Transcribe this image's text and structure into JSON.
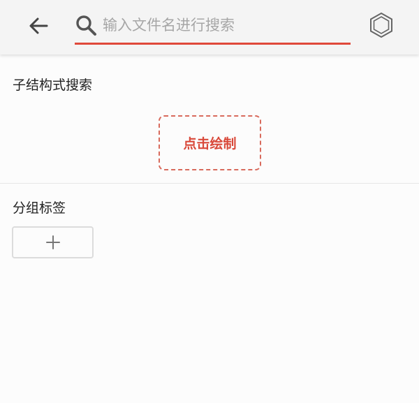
{
  "header": {
    "search_placeholder": "输入文件名进行搜索",
    "search_value": ""
  },
  "structure_search": {
    "title": "子结构式搜索",
    "draw_label": "点击绘制"
  },
  "group_tags": {
    "title": "分组标签",
    "add_symbol": "+"
  },
  "icons": {
    "back": "arrow-left-icon",
    "search": "search-icon",
    "structure": "hexagon-icon",
    "add": "plus-icon"
  },
  "colors": {
    "accent": "#e0493a",
    "dashed_border": "#d86a5c",
    "header_bg": "#f4f4f4",
    "page_bg": "#fcfcfc"
  }
}
